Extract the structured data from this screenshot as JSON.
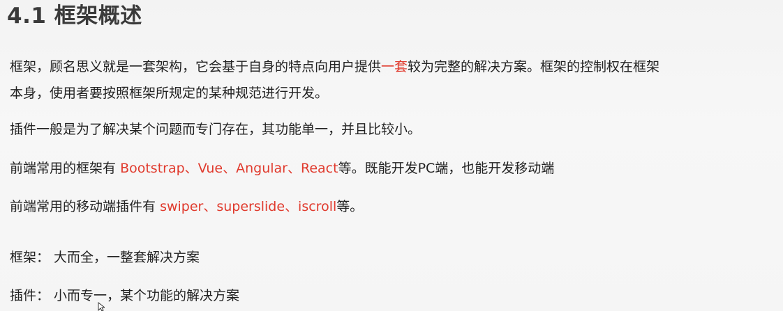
{
  "heading": {
    "text": "4.1 框架概述"
  },
  "paragraphs": {
    "p1": {
      "line1_a": "框架，顾名思义就是一套架构，它会基于自身的特点向用户提供",
      "line1_highlight": "一套",
      "line1_b": "较为完整的解决方案。框架的控制权在框架",
      "line2": "本身，使用者要按照框架所规定的某种规范进行开发。"
    },
    "p2": "插件一般是为了解决某个问题而专门存在，其功能单一，并且比较小。",
    "p3": {
      "prefix": "前端常用的框架有",
      "frameworks": "Bootstrap、Vue、Angular、React",
      "suffix": "等。既能开发PC端，也能开发移动端"
    },
    "p4": {
      "prefix": "前端常用的移动端插件有",
      "plugins": "swiper、superslide、iscroll",
      "suffix": "等。"
    },
    "p5": "框架：  大而全，一整套解决方案",
    "p6": "插件：  小而专一，某个功能的解决方案"
  },
  "colors": {
    "highlight": "#e03a2d",
    "text": "#222222",
    "heading": "#3a3a3a"
  }
}
